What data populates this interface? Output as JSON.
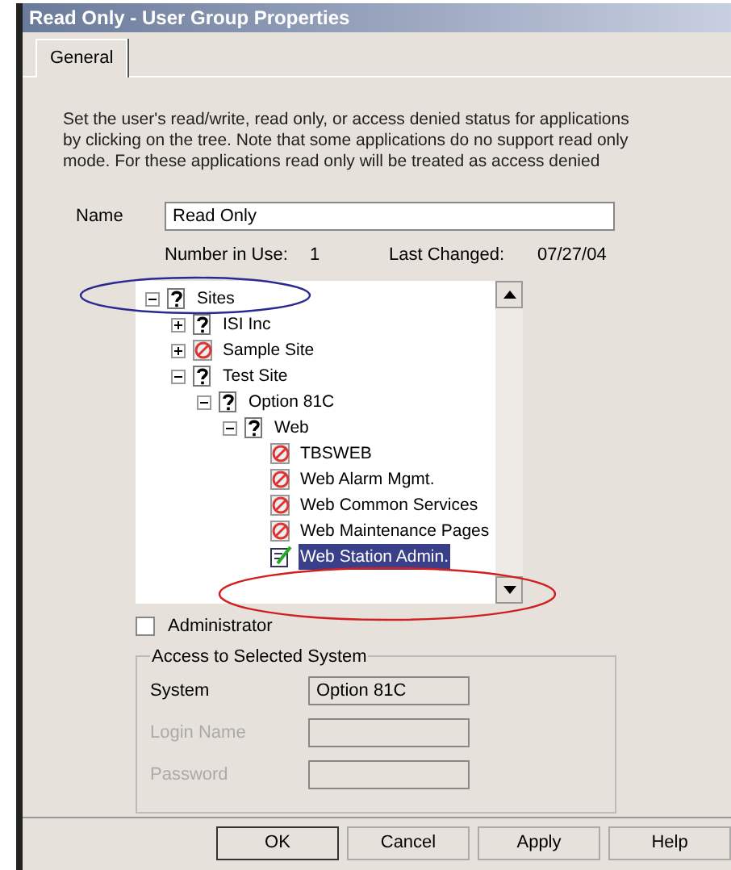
{
  "window": {
    "title": "Read Only - User Group Properties"
  },
  "tabs": [
    {
      "label": "General",
      "selected": true
    }
  ],
  "description": "Set the user's read/write, read only, or access denied status for applications by clicking on the tree. Note that some applications do no support read only mode. For these applications read only will be treated as access denied",
  "name_field": {
    "label": "Name",
    "value": "Read Only"
  },
  "info": {
    "number_label": "Number in Use:",
    "number_value": "1",
    "changed_label": "Last Changed:",
    "changed_value": "07/27/04"
  },
  "tree": [
    {
      "label": "Sites",
      "kind": "unknown",
      "expanded": true,
      "selected": false,
      "children": [
        {
          "label": "ISI Inc",
          "kind": "unknown",
          "expanded": false,
          "selected": false
        },
        {
          "label": "Sample Site",
          "kind": "denied",
          "expanded": false,
          "selected": false
        },
        {
          "label": "Test Site",
          "kind": "unknown",
          "expanded": true,
          "selected": false,
          "children": [
            {
              "label": "Option 81C",
              "kind": "unknown",
              "expanded": true,
              "selected": false,
              "children": [
                {
                  "label": "Web",
                  "kind": "unknown",
                  "expanded": true,
                  "selected": false,
                  "children": [
                    {
                      "label": "TBSWEB",
                      "kind": "denied",
                      "selected": false
                    },
                    {
                      "label": "Web Alarm Mgmt.",
                      "kind": "denied",
                      "selected": false
                    },
                    {
                      "label": "Web Common Services",
                      "kind": "denied",
                      "selected": false
                    },
                    {
                      "label": "Web Maintenance Pages",
                      "kind": "denied",
                      "selected": false
                    },
                    {
                      "label": "Web Station Admin.",
                      "kind": "readwrite",
                      "selected": true
                    }
                  ]
                }
              ]
            }
          ]
        }
      ]
    }
  ],
  "administrator": {
    "label": "Administrator",
    "checked": false
  },
  "access_group": {
    "title": "Access to Selected System",
    "fields": [
      {
        "label": "System",
        "value": "Option 81C",
        "disabled": false
      },
      {
        "label": "Login Name",
        "disabled": true
      },
      {
        "label": "Password",
        "disabled": true
      }
    ]
  },
  "buttons": [
    "OK",
    "Cancel",
    "Apply",
    "Help"
  ]
}
